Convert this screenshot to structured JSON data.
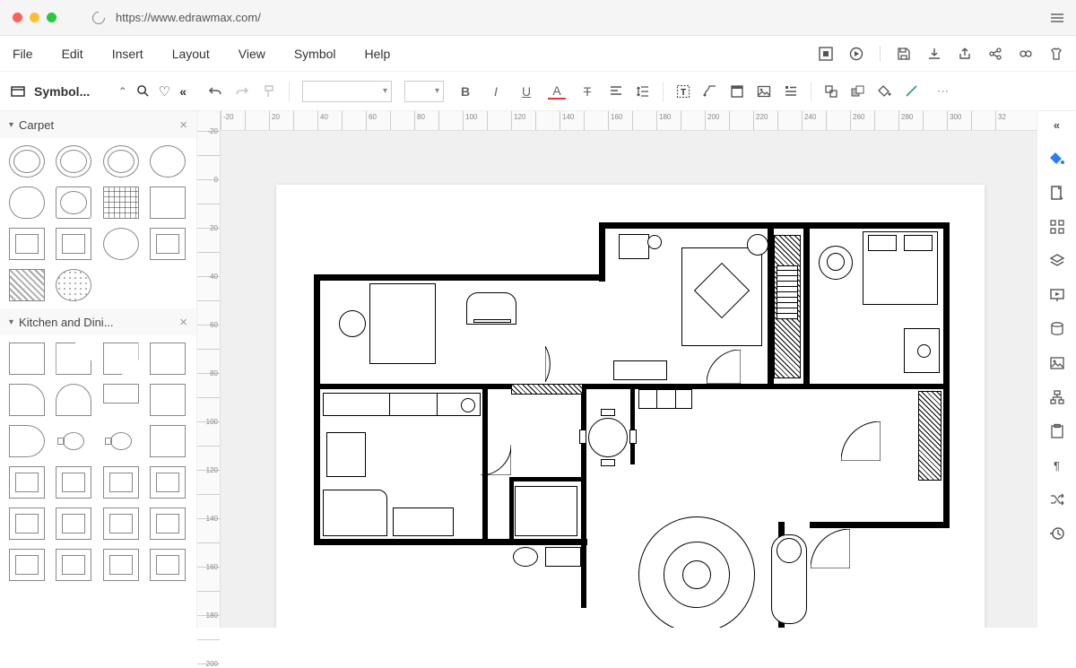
{
  "browser": {
    "url": "https://www.edrawmax.com/"
  },
  "menu": {
    "items": [
      "File",
      "Edit",
      "Insert",
      "Layout",
      "View",
      "Symbol",
      "Help"
    ]
  },
  "symbol_bar": {
    "title": "Symbol..."
  },
  "toolbar": {
    "font_label": "",
    "size_label": "",
    "bold": "B",
    "italic": "I",
    "underline": "U",
    "font_color": "A",
    "clear_format": "T"
  },
  "panels": [
    {
      "title": "Carpet"
    },
    {
      "title": "Kitchen and Dini..."
    }
  ],
  "hruler_ticks": [
    "|-20",
    "|",
    "|20",
    "|",
    "|40",
    "|",
    "|60",
    "|",
    "|80",
    "|",
    "|100",
    "|",
    "|120",
    "|",
    "|140",
    "|",
    "|160",
    "|",
    "|180",
    "|",
    "|200",
    "|",
    "|220",
    "|",
    "|240",
    "|",
    "|260",
    "|",
    "|280",
    "|",
    "|300",
    "|",
    "|32"
  ],
  "vruler_ticks": [
    "|-20",
    "|",
    "0",
    "|",
    "20",
    "|",
    "40",
    "|",
    "60",
    "|",
    "80",
    "|",
    "100",
    "|",
    "120",
    "|",
    "140",
    "|",
    "160",
    "|",
    "180",
    "|",
    "200"
  ],
  "more": "⋯",
  "collapse": "«"
}
